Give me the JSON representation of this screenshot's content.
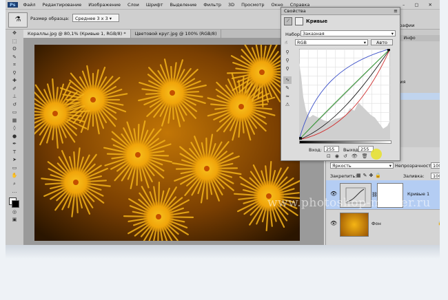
{
  "menu": [
    "Файл",
    "Редактирование",
    "Изображение",
    "Слои",
    "Шрифт",
    "Выделение",
    "Фильтр",
    "3D",
    "Просмотр",
    "Окно",
    "Справка"
  ],
  "options": {
    "sample_size_label": "Размер образца:",
    "sample_size_value": "Среднее 3 х 3"
  },
  "tabs": [
    "Кораллы.jpg @ 80,1% (Кривые 1, RGB/8) *",
    "Цветовой круг.jpg @ 100% (RGB/8)"
  ],
  "properties": {
    "title": "Свойства",
    "subtitle": "Кривые",
    "preset_label": "Набор:",
    "preset_value": "Заказная",
    "channel_value": "RGB",
    "auto_label": "Авто",
    "input_label": "Вход:",
    "input_value": "255",
    "output_label": "Выход:",
    "output_value": "255"
  },
  "right_panel": {
    "text1": "ографии",
    "tab1": "ия",
    "tab2": "Инфо",
    "text2": "ения"
  },
  "layers": {
    "lock_label": "Закрепить:",
    "blend_mode": "Яркость",
    "opacity_label": "Непрозрачность:",
    "opacity_value": "100%",
    "fill_label": "Заливка:",
    "fill_value": "100%",
    "items": [
      {
        "name": "Кривые 1"
      },
      {
        "name": "Фон"
      }
    ]
  },
  "watermark": "www.photoshop-master.ru",
  "colors": {
    "curve_red": "#d03030",
    "curve_green": "#2ea02e",
    "curve_blue": "#3a4fc8",
    "highlight": "#e8e22a",
    "coral": "#e8a10e"
  }
}
